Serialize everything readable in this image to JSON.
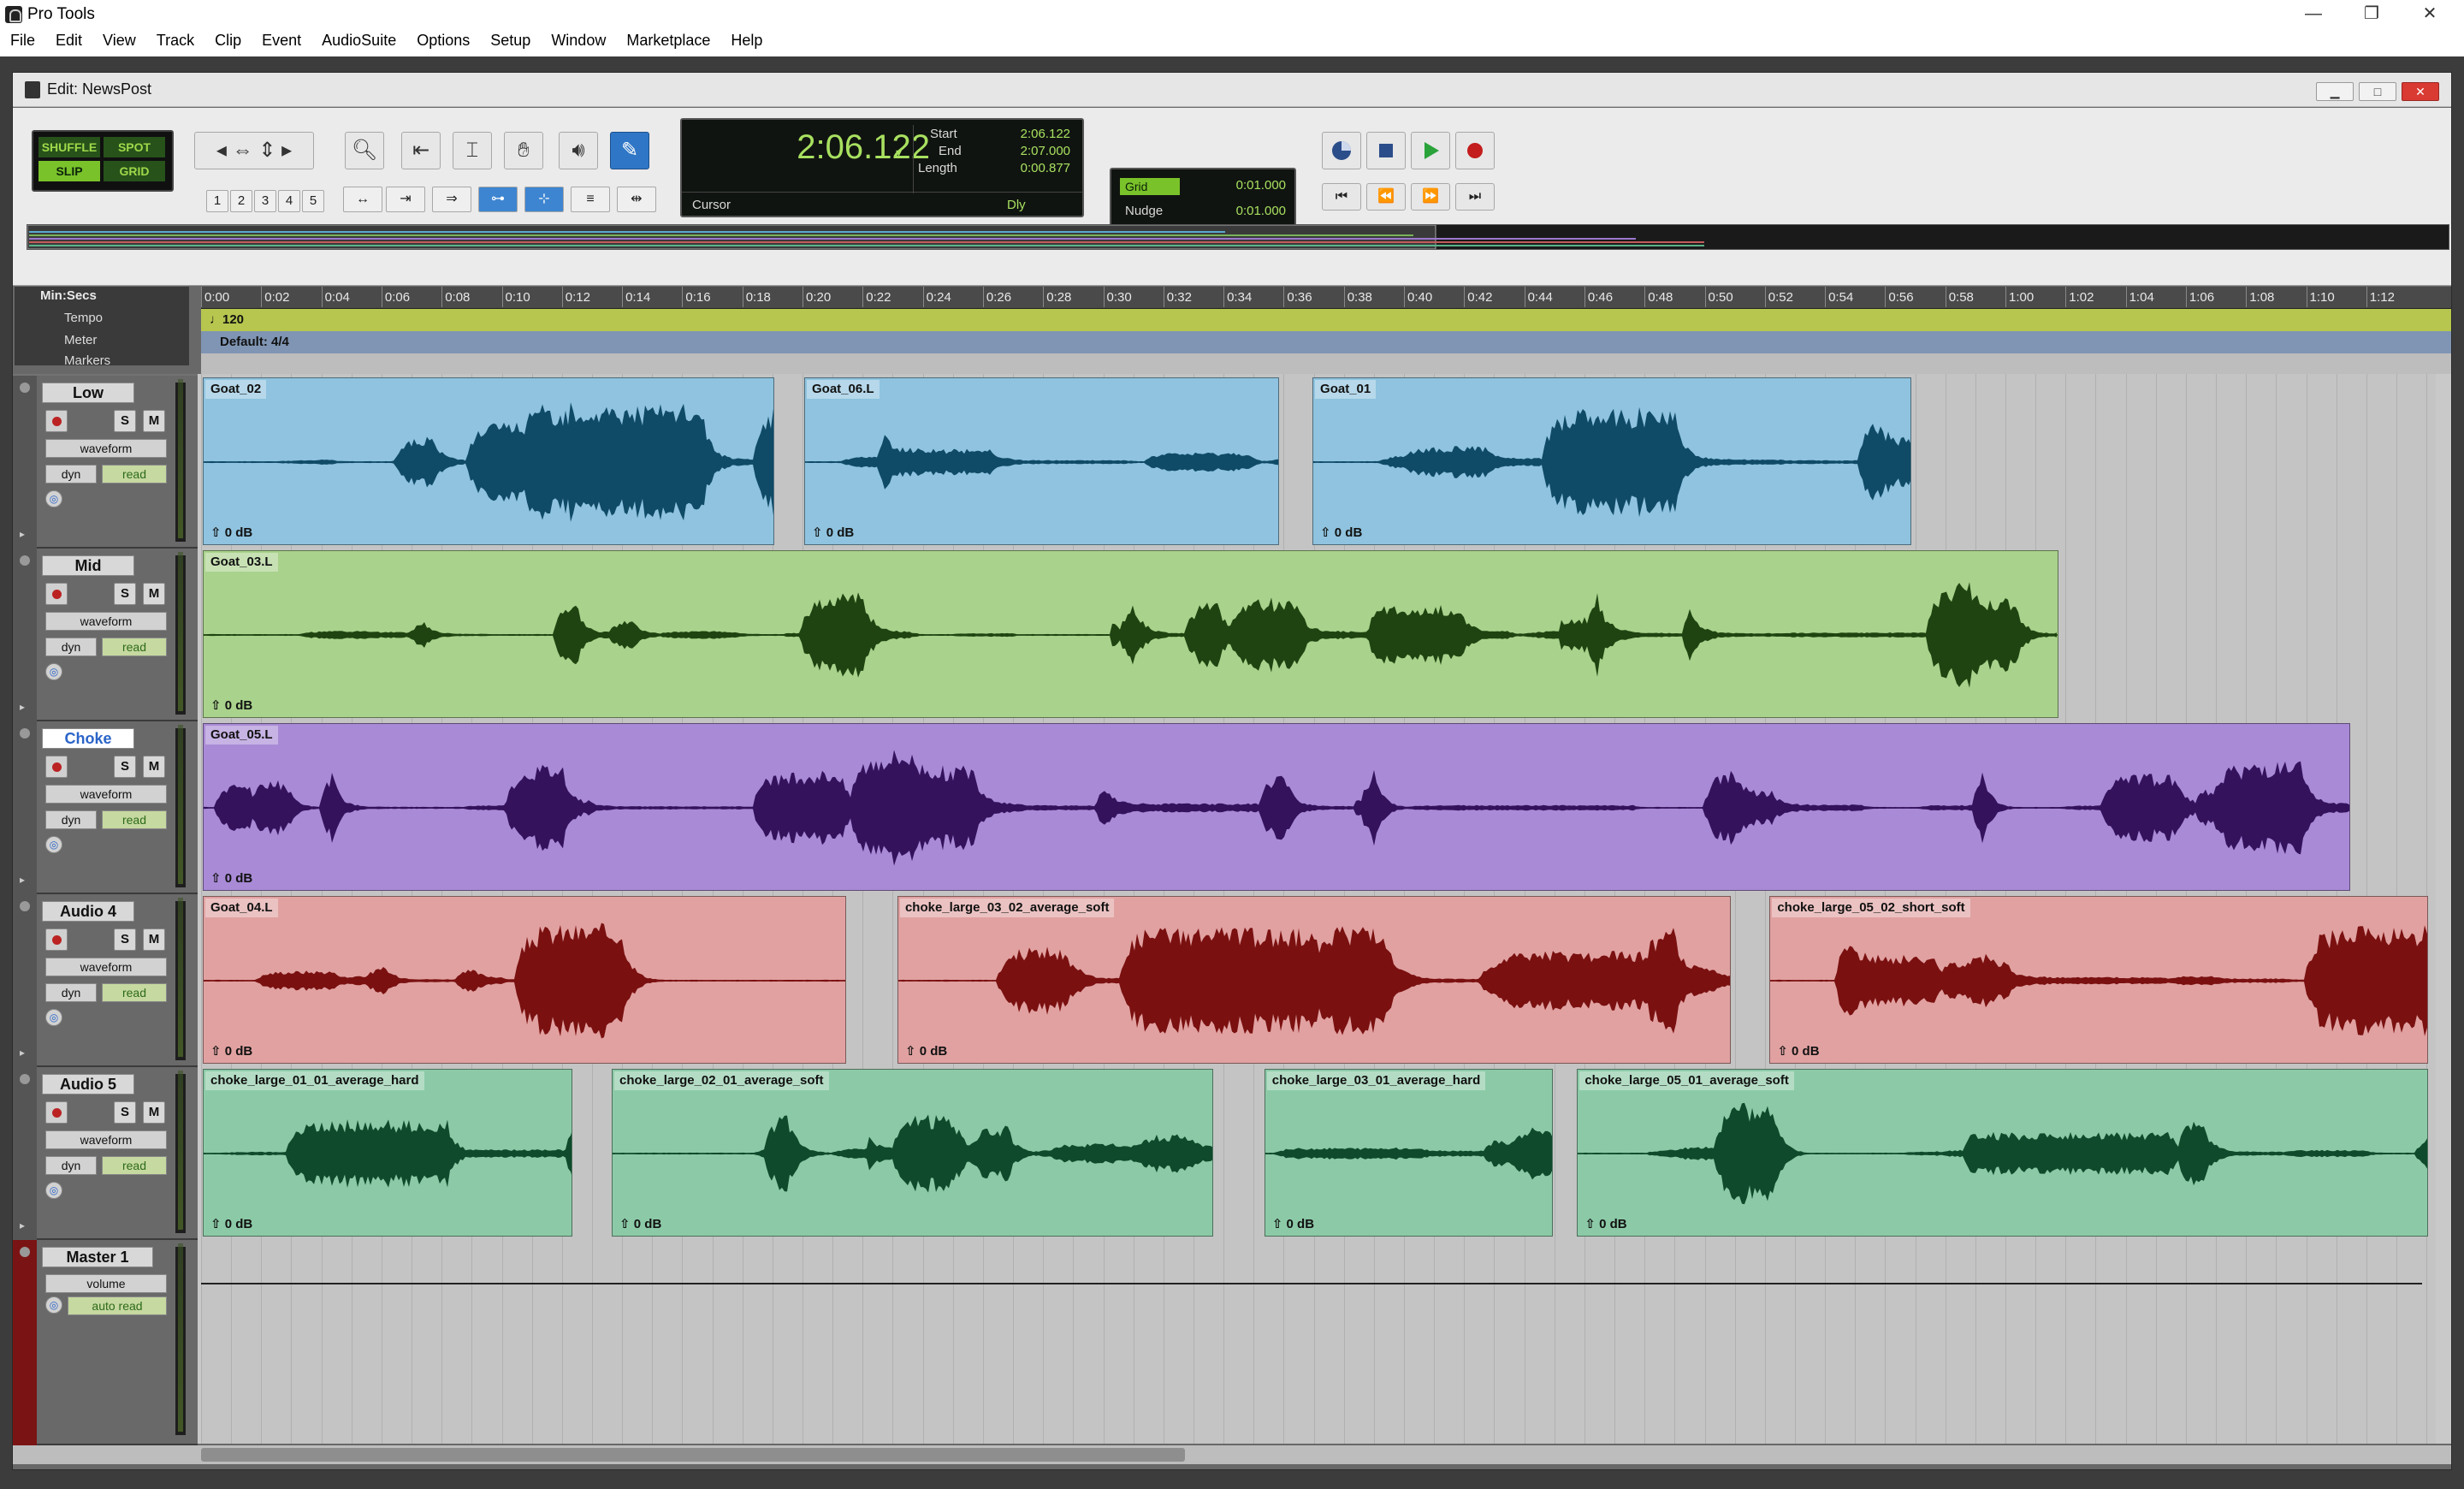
{
  "os": {
    "title": "Pro Tools",
    "minimize": "—",
    "restore": "❐",
    "close": "✕"
  },
  "menu": [
    "File",
    "Edit",
    "View",
    "Track",
    "Clip",
    "Event",
    "AudioSuite",
    "Options",
    "Setup",
    "Window",
    "Marketplace",
    "Help"
  ],
  "edit_window": {
    "title": "Edit: NewsPost"
  },
  "modes": {
    "shuffle": "SHUFFLE",
    "spot": "SPOT",
    "slip": "SLIP",
    "grid": "GRID"
  },
  "zoom_presets": [
    "1",
    "2",
    "3",
    "4",
    "5"
  ],
  "counter": {
    "main": "2:06.122",
    "start_label": "Start",
    "end_label": "End",
    "length_label": "Length",
    "start": "2:06.122",
    "end": "2:07.000",
    "length": "0:00.877",
    "cursor_label": "Cursor",
    "dly_label": "Dly"
  },
  "grid_nudge": {
    "grid_label": "Grid",
    "grid_value": "0:01.000",
    "nudge_label": "Nudge",
    "nudge_value": "0:01.000"
  },
  "rulers": {
    "main": "Min:Secs",
    "tempo": "Tempo",
    "meter": "Meter",
    "markers": "Markers",
    "tempo_value": "♩120",
    "meter_value": "Default: 4/4",
    "ticks": [
      "0:00",
      "0:02",
      "0:04",
      "0:06",
      "0:08",
      "0:10",
      "0:12",
      "0:14",
      "0:16",
      "0:18",
      "0:20",
      "0:22",
      "0:24",
      "0:26",
      "0:28",
      "0:30",
      "0:32",
      "0:34",
      "0:36",
      "0:38",
      "0:40",
      "0:42",
      "0:44",
      "0:46",
      "0:48",
      "0:50",
      "0:52",
      "0:54",
      "0:56",
      "0:58",
      "1:00",
      "1:02",
      "1:04",
      "1:06",
      "1:08",
      "1:10",
      "1:12"
    ]
  },
  "tracks": [
    {
      "name": "Low",
      "view": "waveform",
      "dyn": "dyn",
      "automation": "read",
      "color": "#8fc3df",
      "wave_color": "#0f4a66",
      "clips": [
        {
          "name": "Goat_02",
          "start": 0.0,
          "end": 19.0,
          "gain": "0 dB"
        },
        {
          "name": "Goat_06.L",
          "start": 20.0,
          "end": 35.8,
          "gain": "0 dB"
        },
        {
          "name": "Goat_01",
          "start": 36.9,
          "end": 56.8,
          "gain": "0 dB"
        }
      ]
    },
    {
      "name": "Mid",
      "view": "waveform",
      "dyn": "dyn",
      "automation": "read",
      "color": "#a9d28c",
      "wave_color": "#1f4411",
      "clips": [
        {
          "name": "Goat_03.L",
          "start": 0.0,
          "end": 61.7,
          "gain": "0 dB"
        }
      ]
    },
    {
      "name": "Choke",
      "view": "waveform",
      "dyn": "dyn",
      "automation": "read",
      "color": "#a98ad6",
      "wave_color": "#34125c",
      "clips": [
        {
          "name": "Goat_05.L",
          "start": 0.0,
          "end": 71.4,
          "gain": "0 dB"
        }
      ]
    },
    {
      "name": "Audio 4",
      "view": "waveform",
      "dyn": "dyn",
      "automation": "read",
      "color": "#e1a1a1",
      "wave_color": "#7a1010",
      "clips": [
        {
          "name": "Goat_04.L",
          "start": 0.0,
          "end": 21.4,
          "gain": "0 dB"
        },
        {
          "name": "choke_large_03_02_average_soft",
          "start": 23.1,
          "end": 50.8,
          "gain": "0 dB"
        },
        {
          "name": "choke_large_05_02_short_soft",
          "start": 52.1,
          "end": 74.0,
          "gain": "0 dB"
        }
      ]
    },
    {
      "name": "Audio 5",
      "view": "waveform",
      "dyn": "dyn",
      "automation": "read",
      "color": "#8ccaa7",
      "wave_color": "#0f4a2c",
      "clips": [
        {
          "name": "choke_large_01_01_average_hard",
          "start": 0.0,
          "end": 12.3,
          "gain": "0 dB"
        },
        {
          "name": "choke_large_02_01_average_soft",
          "start": 13.6,
          "end": 33.6,
          "gain": "0 dB"
        },
        {
          "name": "choke_large_03_01_average_hard",
          "start": 35.3,
          "end": 44.9,
          "gain": "0 dB"
        },
        {
          "name": "choke_large_05_01_average_soft",
          "start": 45.7,
          "end": 74.0,
          "gain": "0 dB"
        }
      ]
    }
  ],
  "master": {
    "name": "Master 1",
    "view": "volume",
    "automation": "auto read"
  }
}
